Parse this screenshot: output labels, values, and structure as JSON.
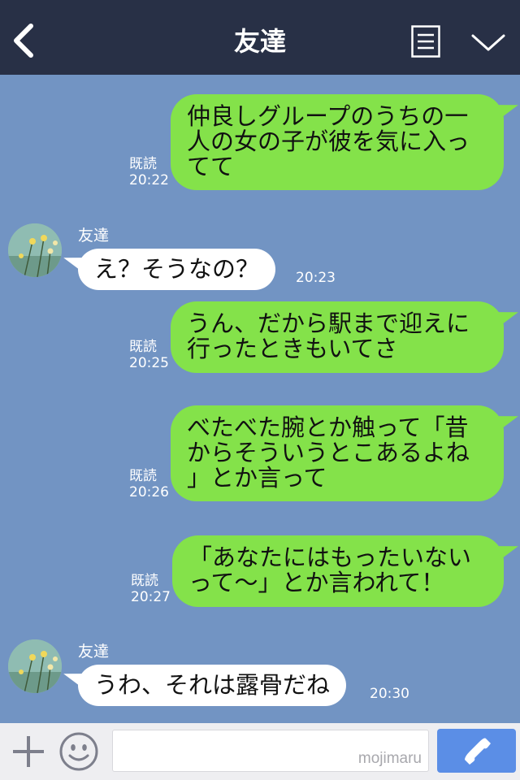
{
  "header": {
    "title": "友達",
    "icons": {
      "back": "chevron-left-icon",
      "menu": "list-icon",
      "collapse": "chevron-down-icon"
    }
  },
  "messages": [
    {
      "side": "out",
      "lines": [
        "仲良しグループのうちの一",
        "人の女の子が彼を気に入っ",
        "てて"
      ],
      "read": "既読",
      "time": "20:22"
    },
    {
      "side": "in",
      "sender": "友達",
      "text": "え？そうなの？",
      "time": "20:23"
    },
    {
      "side": "out",
      "lines": [
        "うん、だから駅まで迎えに",
        "行ったときもいてさ"
      ],
      "read": "既読",
      "time": "20:25"
    },
    {
      "side": "out",
      "lines": [
        "べたべた腕とか触って「昔",
        "からそういうとこあるよね",
        "」とか言って"
      ],
      "read": "既読",
      "time": "20:26"
    },
    {
      "side": "out",
      "lines": [
        "「あなたにはもったいない",
        "って〜」とか言われて！"
      ],
      "read": "既読",
      "time": "20:27"
    },
    {
      "side": "in",
      "sender": "友達",
      "text": "うわ、それは露骨だね",
      "time": "20:30"
    }
  ],
  "input_bar": {
    "watermark": "mojimaru",
    "icons": {
      "plus": "plus-icon",
      "emoji": "smiley-icon",
      "call": "phone-icon"
    }
  },
  "colors": {
    "header_bg": "#283046",
    "chat_bg": "#7294c3",
    "bubble_out": "#84e24a",
    "bubble_in": "#ffffff",
    "call_button": "#5b8ee6"
  }
}
